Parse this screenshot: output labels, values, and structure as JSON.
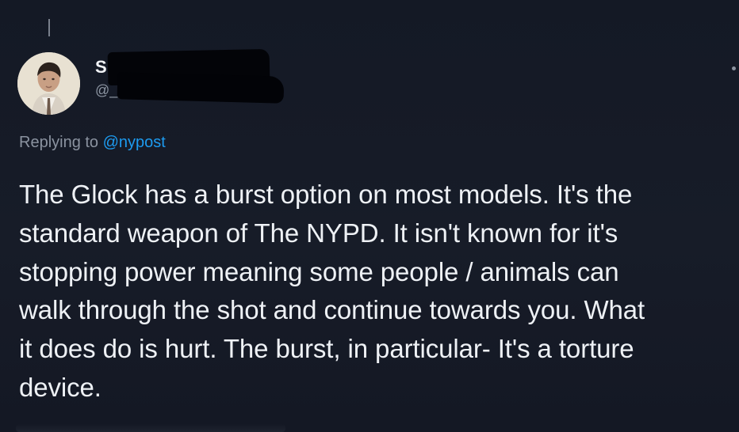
{
  "tweet": {
    "author": {
      "name_visible": "S",
      "handle_visible": "@_"
    },
    "reply": {
      "prefix": "Replying to ",
      "mention": "@nypost"
    },
    "body": "The Glock has a burst option on most models. It's the\nstandard weapon of The NYPD. It isn't known for it's\nstopping power meaning some people / animals can\nwalk through the shot and continue towards you. What\nit does do is hurt. The burst, in particular- It's a torture\ndevice."
  },
  "colors": {
    "background": "#151a26",
    "text": "#eef1f5",
    "secondary_text": "#8b93a0",
    "mention": "#1d9bf0",
    "redaction": "#030408"
  }
}
